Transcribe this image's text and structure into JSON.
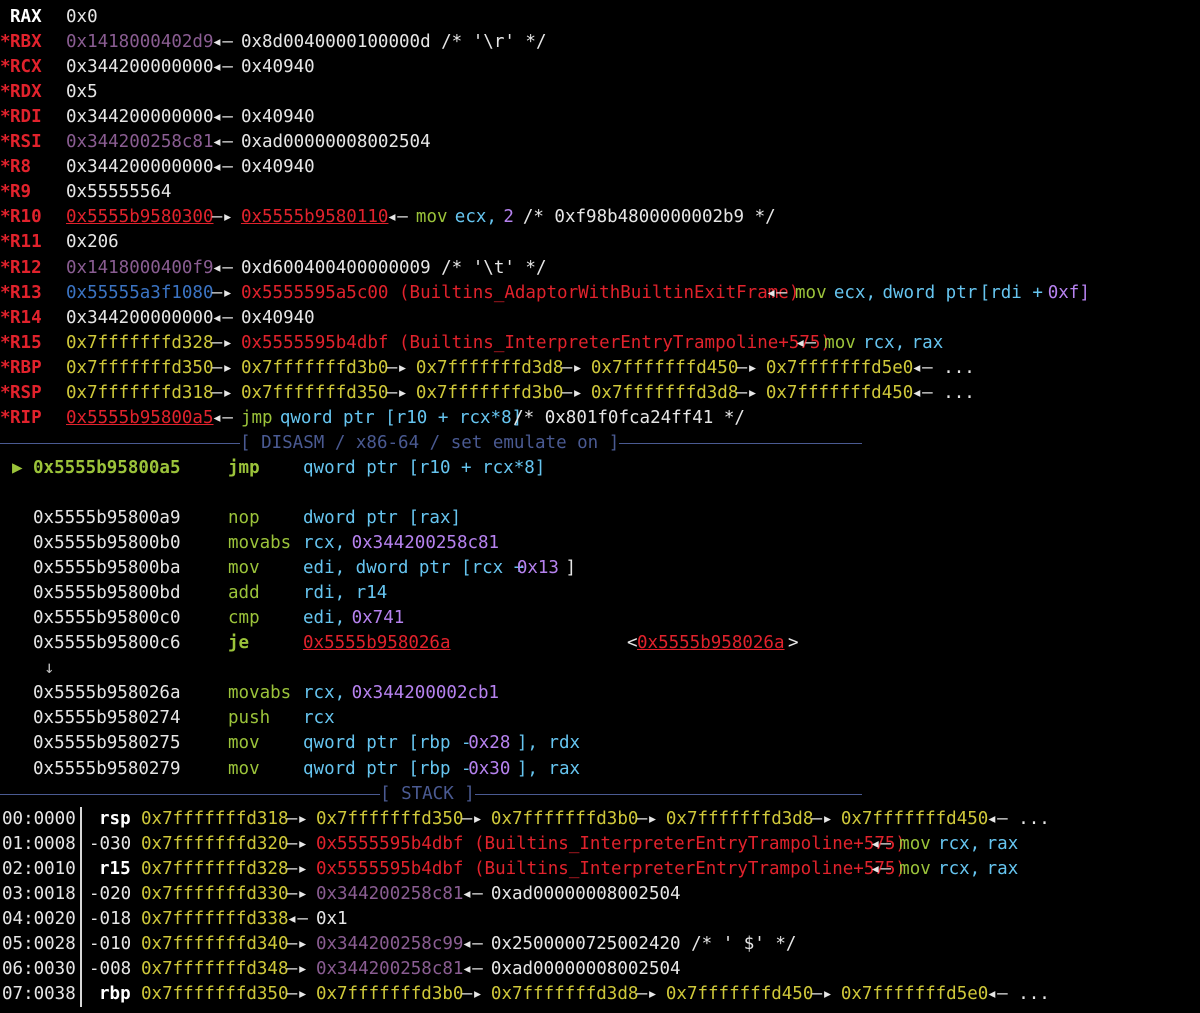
{
  "registers": [
    {
      "name": "RAX",
      "star": "",
      "parts": [
        {
          "t": "0x0",
          "c": "w"
        }
      ]
    },
    {
      "name": "RBX",
      "star": "*",
      "parts": [
        {
          "t": "0x1418000402d9",
          "c": "mag"
        },
        {
          "t": "◂—",
          "c": "w",
          "sp": true
        },
        {
          "t": "0x8d0040000100000d /* '\\r' */",
          "c": "w"
        }
      ]
    },
    {
      "name": "RCX",
      "star": "*",
      "parts": [
        {
          "t": "0x344200000000",
          "c": "w"
        },
        {
          "t": "◂—",
          "c": "w"
        },
        {
          "t": "0x40940",
          "c": "w"
        }
      ]
    },
    {
      "name": "RDX",
      "star": "*",
      "parts": [
        {
          "t": "0x5",
          "c": "w"
        }
      ]
    },
    {
      "name": "RDI",
      "star": "*",
      "parts": [
        {
          "t": "0x344200000000",
          "c": "w"
        },
        {
          "t": "◂—",
          "c": "w"
        },
        {
          "t": "0x40940",
          "c": "w"
        }
      ]
    },
    {
      "name": "RSI",
      "star": "*",
      "parts": [
        {
          "t": "0x344200258c81",
          "c": "mag"
        },
        {
          "t": "◂—",
          "c": "w"
        },
        {
          "t": "0xad00000008002504",
          "c": "w"
        }
      ]
    },
    {
      "name": "R8",
      "star": "*",
      "parts": [
        {
          "t": "0x344200000000",
          "c": "w"
        },
        {
          "t": "◂—",
          "c": "w"
        },
        {
          "t": "0x40940",
          "c": "w"
        }
      ]
    },
    {
      "name": "R9",
      "star": "*",
      "parts": [
        {
          "t": "0x55555564",
          "c": "w"
        }
      ]
    },
    {
      "name": "R10",
      "star": "*",
      "parts": [
        {
          "t": "0x5555b9580300",
          "c": "red ul"
        },
        {
          "t": "—▸",
          "c": "w"
        },
        {
          "t": "0x5555b9580110",
          "c": "red ul"
        },
        {
          "t": "◂—",
          "c": "w"
        },
        {
          "t": "mov",
          "c": "grn"
        },
        {
          "t": "ecx,",
          "c": "cyn"
        },
        {
          "t": "2",
          "c": "pur"
        },
        {
          "t": "/* 0xf98b4800000002b9 */",
          "c": "w"
        }
      ]
    },
    {
      "name": "R11",
      "star": "*",
      "parts": [
        {
          "t": "0x206",
          "c": "w"
        }
      ]
    },
    {
      "name": "R12",
      "star": "*",
      "parts": [
        {
          "t": "0x1418000400f9",
          "c": "mag"
        },
        {
          "t": "◂—",
          "c": "w"
        },
        {
          "t": "0xd600400400000009 /* '\\t' */",
          "c": "w"
        }
      ]
    },
    {
      "name": "R13",
      "star": "*",
      "parts": [
        {
          "t": "0x55555a3f1080",
          "c": "blu"
        },
        {
          "t": "—▸",
          "c": "w"
        },
        {
          "t": "0x5555595a5c00 (Builtins_AdaptorWithBuiltinExitFrame)",
          "c": "red"
        },
        {
          "t": "◂—",
          "c": "w"
        },
        {
          "t": "mov",
          "c": "grn"
        },
        {
          "t": "ecx,",
          "c": "cyn"
        },
        {
          "t": "dword ptr",
          "c": "cyn"
        },
        {
          "t": "[rdi +",
          "c": "cyn"
        },
        {
          "t": "0xf]",
          "c": "pur"
        }
      ]
    },
    {
      "name": "R14",
      "star": "*",
      "parts": [
        {
          "t": "0x344200000000",
          "c": "w"
        },
        {
          "t": "◂—",
          "c": "w"
        },
        {
          "t": "0x40940",
          "c": "w"
        }
      ]
    },
    {
      "name": "R15",
      "star": "*",
      "parts": [
        {
          "t": "0x7fffffffd328",
          "c": "yel"
        },
        {
          "t": "—▸",
          "c": "w"
        },
        {
          "t": "0x5555595b4dbf (Builtins_InterpreterEntryTrampoline+575)",
          "c": "red"
        },
        {
          "t": "◂—",
          "c": "w"
        },
        {
          "t": "mov",
          "c": "grn"
        },
        {
          "t": "rcx,",
          "c": "cyn"
        },
        {
          "t": "rax",
          "c": "cyn"
        }
      ]
    },
    {
      "name": "RBP",
      "star": "*",
      "parts": [
        {
          "t": "0x7fffffffd350",
          "c": "yel"
        },
        {
          "t": "—▸",
          "c": "w"
        },
        {
          "t": "0x7fffffffd3b0",
          "c": "yel"
        },
        {
          "t": "—▸",
          "c": "w"
        },
        {
          "t": "0x7fffffffd3d8",
          "c": "yel"
        },
        {
          "t": "—▸",
          "c": "w"
        },
        {
          "t": "0x7fffffffd450",
          "c": "yel"
        },
        {
          "t": "—▸",
          "c": "w"
        },
        {
          "t": "0x7fffffffd5e0",
          "c": "yel"
        },
        {
          "t": "◂— ...",
          "c": "w"
        }
      ]
    },
    {
      "name": "RSP",
      "star": "*",
      "parts": [
        {
          "t": "0x7fffffffd318",
          "c": "yel"
        },
        {
          "t": "—▸",
          "c": "w"
        },
        {
          "t": "0x7fffffffd350",
          "c": "yel"
        },
        {
          "t": "—▸",
          "c": "w"
        },
        {
          "t": "0x7fffffffd3b0",
          "c": "yel"
        },
        {
          "t": "—▸",
          "c": "w"
        },
        {
          "t": "0x7fffffffd3d8",
          "c": "yel"
        },
        {
          "t": "—▸",
          "c": "w"
        },
        {
          "t": "0x7fffffffd450",
          "c": "yel"
        },
        {
          "t": "◂— ...",
          "c": "w"
        }
      ]
    },
    {
      "name": "RIP",
      "star": "*",
      "parts": [
        {
          "t": "0x5555b95800a5",
          "c": "red ul"
        },
        {
          "t": "◂—",
          "c": "w"
        },
        {
          "t": "jmp",
          "c": "grn"
        },
        {
          "t": "qword ptr [r10 + rcx*8]",
          "c": "cyn"
        },
        {
          "t": "/* 0x801f0fca24ff41 */",
          "c": "w"
        }
      ]
    }
  ],
  "disasm_header": "[ DISASM / x86-64 / set emulate on ]",
  "current_marker": "▶",
  "disasm": [
    {
      "addr": "0x5555b95800a5",
      "mn": "jmp",
      "ops": [
        {
          "t": "qword ptr [r10 + rcx*8]",
          "c": "cyn"
        }
      ],
      "current": true
    },
    {
      "blank": true
    },
    {
      "addr": "0x5555b95800a9",
      "mn": "nop",
      "ops": [
        {
          "t": "dword ptr [rax]",
          "c": "cyn"
        }
      ]
    },
    {
      "addr": "0x5555b95800b0",
      "mn": "movabs",
      "ops": [
        {
          "t": "rcx,",
          "c": "cyn"
        },
        {
          "t": "0x344200258c81",
          "c": "pur"
        }
      ]
    },
    {
      "addr": "0x5555b95800ba",
      "mn": "mov",
      "ops": [
        {
          "t": "edi, dword ptr [rcx +",
          "c": "cyn"
        },
        {
          "t": "0x13",
          "c": "pur"
        },
        {
          "t": "]",
          "c": "w"
        }
      ]
    },
    {
      "addr": "0x5555b95800bd",
      "mn": "add",
      "ops": [
        {
          "t": "rdi, r14",
          "c": "cyn"
        }
      ]
    },
    {
      "addr": "0x5555b95800c0",
      "mn": "cmp",
      "ops": [
        {
          "t": "edi,",
          "c": "cyn"
        },
        {
          "t": "0x741",
          "c": "pur"
        }
      ]
    },
    {
      "addr": "0x5555b95800c6",
      "mn": "je",
      "bold": true,
      "ops": [
        {
          "t": "0x5555b958026a",
          "c": "red ul"
        }
      ],
      "target": "0x5555b958026a"
    },
    {
      "arrow": "↓"
    },
    {
      "addr": "0x5555b958026a",
      "mn": "movabs",
      "ops": [
        {
          "t": "rcx,",
          "c": "cyn"
        },
        {
          "t": "0x344200002cb1",
          "c": "pur"
        }
      ]
    },
    {
      "addr": "0x5555b9580274",
      "mn": "push",
      "ops": [
        {
          "t": "rcx",
          "c": "cyn"
        }
      ]
    },
    {
      "addr": "0x5555b9580275",
      "mn": "mov",
      "ops": [
        {
          "t": "qword ptr [rbp -",
          "c": "cyn"
        },
        {
          "t": "0x28",
          "c": "pur"
        },
        {
          "t": "], rdx",
          "c": "cyn"
        }
      ]
    },
    {
      "addr": "0x5555b9580279",
      "mn": "mov",
      "ops": [
        {
          "t": "qword ptr [rbp -",
          "c": "cyn"
        },
        {
          "t": "0x30",
          "c": "pur"
        },
        {
          "t": "], rax",
          "c": "cyn"
        }
      ]
    }
  ],
  "stack_header": "[ STACK ]",
  "stack": [
    {
      "idx": "00:0000",
      "off": "rsp",
      "offbold": true,
      "parts": [
        {
          "t": "0x7fffffffd318",
          "c": "yel"
        },
        {
          "t": "—▸",
          "c": "w"
        },
        {
          "t": "0x7fffffffd350",
          "c": "yel"
        },
        {
          "t": "—▸",
          "c": "w"
        },
        {
          "t": "0x7fffffffd3b0",
          "c": "yel"
        },
        {
          "t": "—▸",
          "c": "w"
        },
        {
          "t": "0x7fffffffd3d8",
          "c": "yel"
        },
        {
          "t": "—▸",
          "c": "w"
        },
        {
          "t": "0x7fffffffd450",
          "c": "yel"
        },
        {
          "t": "◂— ...",
          "c": "w"
        }
      ]
    },
    {
      "idx": "01:0008",
      "off": "-030",
      "parts": [
        {
          "t": "0x7fffffffd320",
          "c": "yel"
        },
        {
          "t": "—▸",
          "c": "w"
        },
        {
          "t": "0x5555595b4dbf (Builtins_InterpreterEntryTrampoline+575)",
          "c": "red"
        },
        {
          "t": "◂—",
          "c": "w"
        },
        {
          "t": "mov",
          "c": "grn"
        },
        {
          "t": "rcx,",
          "c": "cyn"
        },
        {
          "t": "rax",
          "c": "cyn"
        }
      ]
    },
    {
      "idx": "02:0010",
      "off": "r15",
      "offbold": true,
      "parts": [
        {
          "t": "0x7fffffffd328",
          "c": "yel"
        },
        {
          "t": "—▸",
          "c": "w"
        },
        {
          "t": "0x5555595b4dbf (Builtins_InterpreterEntryTrampoline+575)",
          "c": "red"
        },
        {
          "t": "◂—",
          "c": "w"
        },
        {
          "t": "mov",
          "c": "grn"
        },
        {
          "t": "rcx,",
          "c": "cyn"
        },
        {
          "t": "rax",
          "c": "cyn"
        }
      ]
    },
    {
      "idx": "03:0018",
      "off": "-020",
      "parts": [
        {
          "t": "0x7fffffffd330",
          "c": "yel"
        },
        {
          "t": "—▸",
          "c": "w"
        },
        {
          "t": "0x344200258c81",
          "c": "mag"
        },
        {
          "t": "◂—",
          "c": "w"
        },
        {
          "t": "0xad00000008002504",
          "c": "w"
        }
      ]
    },
    {
      "idx": "04:0020",
      "off": "-018",
      "parts": [
        {
          "t": "0x7fffffffd338",
          "c": "yel"
        },
        {
          "t": "◂—",
          "c": "w"
        },
        {
          "t": "0x1",
          "c": "w"
        }
      ]
    },
    {
      "idx": "05:0028",
      "off": "-010",
      "parts": [
        {
          "t": "0x7fffffffd340",
          "c": "yel"
        },
        {
          "t": "—▸",
          "c": "w"
        },
        {
          "t": "0x344200258c99",
          "c": "mag"
        },
        {
          "t": "◂—",
          "c": "w"
        },
        {
          "t": "0x2500000725002420 /* ' $' */",
          "c": "w"
        }
      ]
    },
    {
      "idx": "06:0030",
      "off": "-008",
      "parts": [
        {
          "t": "0x7fffffffd348",
          "c": "yel"
        },
        {
          "t": "—▸",
          "c": "w"
        },
        {
          "t": "0x344200258c81",
          "c": "mag"
        },
        {
          "t": "◂—",
          "c": "w"
        },
        {
          "t": "0xad00000008002504",
          "c": "w"
        }
      ]
    },
    {
      "idx": "07:0038",
      "off": "rbp",
      "offbold": true,
      "parts": [
        {
          "t": "0x7fffffffd350",
          "c": "yel"
        },
        {
          "t": "—▸",
          "c": "w"
        },
        {
          "t": "0x7fffffffd3b0",
          "c": "yel"
        },
        {
          "t": "—▸",
          "c": "w"
        },
        {
          "t": "0x7fffffffd3d8",
          "c": "yel"
        },
        {
          "t": "—▸",
          "c": "w"
        },
        {
          "t": "0x7fffffffd450",
          "c": "yel"
        },
        {
          "t": "—▸",
          "c": "w"
        },
        {
          "t": "0x7fffffffd5e0",
          "c": "yel"
        },
        {
          "t": "◂— ...",
          "c": "w"
        }
      ]
    }
  ]
}
